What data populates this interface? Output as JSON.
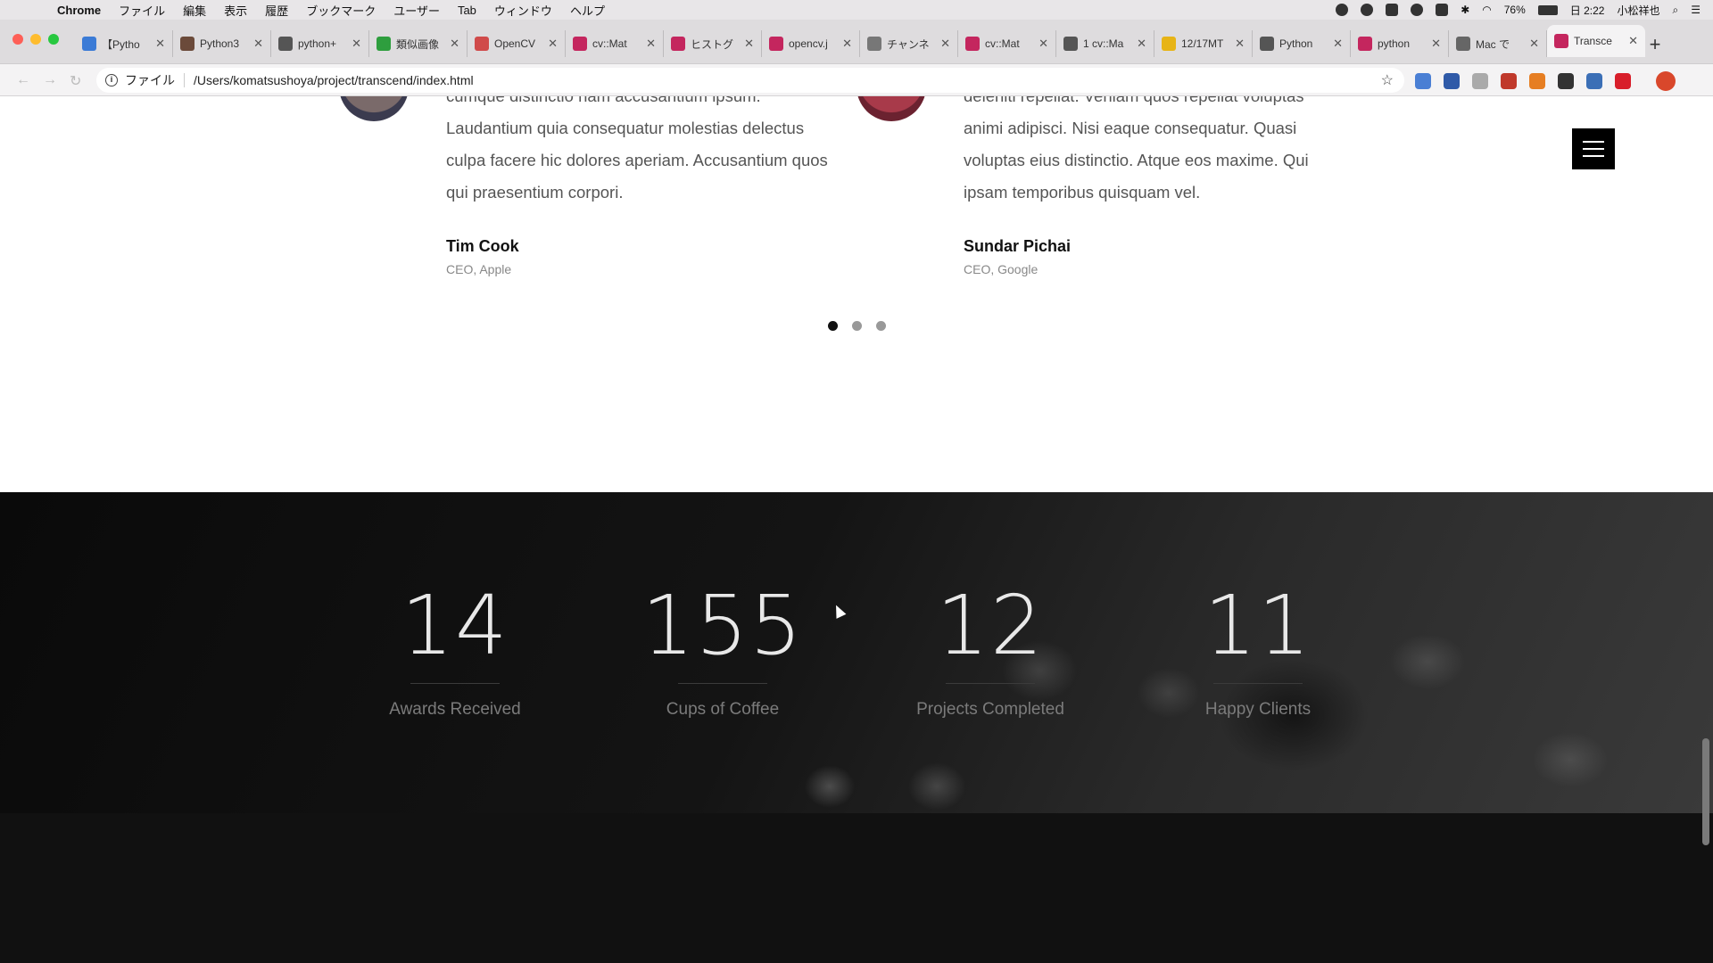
{
  "menubar": {
    "app": "Chrome",
    "items": [
      "ファイル",
      "編集",
      "表示",
      "履歴",
      "ブックマーク",
      "ユーザー",
      "Tab",
      "ウィンドウ",
      "ヘルプ"
    ],
    "battery": "76%",
    "clock": "日 2:22",
    "user": "小松祥也"
  },
  "tabs": [
    {
      "title": "【Pytho",
      "color": "#3b7bd6"
    },
    {
      "title": "Python3",
      "color": "#6b4a3a"
    },
    {
      "title": "python+",
      "color": "#555555"
    },
    {
      "title": "類似画像",
      "color": "#2e9e3e"
    },
    {
      "title": "OpenCV",
      "color": "#d04a4a"
    },
    {
      "title": "cv::Mat",
      "color": "#c4265e"
    },
    {
      "title": "ヒストグ",
      "color": "#c4265e"
    },
    {
      "title": "opencv.j",
      "color": "#c4265e"
    },
    {
      "title": "チャンネ",
      "color": "#777777"
    },
    {
      "title": "cv::Mat",
      "color": "#c4265e"
    },
    {
      "title": "1 cv::Ma",
      "color": "#555555"
    },
    {
      "title": "12/17MT",
      "color": "#e7b416"
    },
    {
      "title": "Python",
      "color": "#555555"
    },
    {
      "title": "python",
      "color": "#c4265e"
    },
    {
      "title": "Mac で",
      "color": "#666666"
    },
    {
      "title": "Transce",
      "color": "#c4265e",
      "active": true
    }
  ],
  "omnibox": {
    "scheme": "ファイル",
    "url": "/Users/komatsushoya/project/transcend/index.html"
  },
  "testimonials": [
    {
      "quote": "cumque distinctio nam accusantium ipsum. Laudantium quia consequatur molestias delectus culpa facere hic dolores aperiam. Accusantium quos qui praesentium corpori.",
      "name": "Tim Cook",
      "role": "CEO, Apple"
    },
    {
      "quote": "deleniti repellat. Veniam quos repellat voluptas animi adipisci. Nisi eaque consequatur. Quasi voluptas eius distinctio. Atque eos maxime. Qui ipsam temporibus quisquam vel.",
      "name": "Sundar Pichai",
      "role": "CEO, Google"
    }
  ],
  "carousel": {
    "pages": 3,
    "active": 1
  },
  "stats": [
    {
      "value": "14",
      "label": "Awards Received"
    },
    {
      "value": "155",
      "label": "Cups of Coffee"
    },
    {
      "value": "12",
      "label": "Projects Completed"
    },
    {
      "value": "11",
      "label": "Happy Clients"
    }
  ]
}
